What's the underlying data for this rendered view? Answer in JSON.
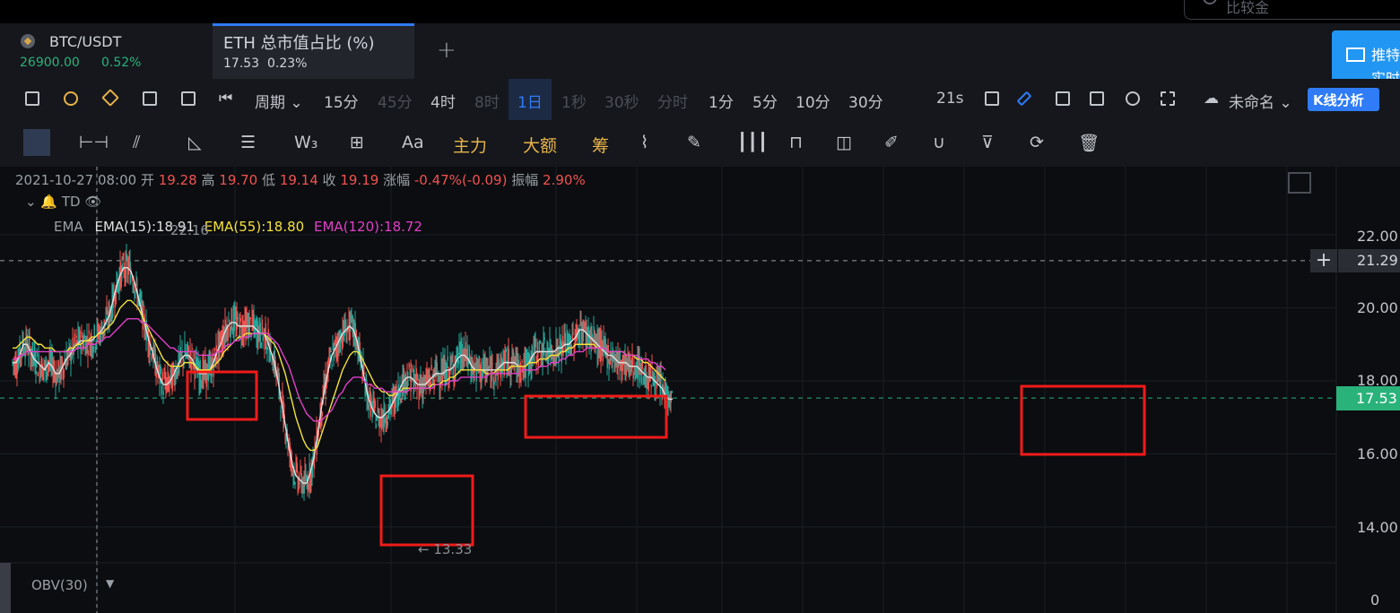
{
  "search": {
    "placeholder": "比较金"
  },
  "tabs": [
    {
      "name": "BTC/USDT",
      "price": "26900.00",
      "change": "0.52%"
    },
    {
      "name": "ETH 总市值占比 (%)",
      "price": "17.53",
      "change": "0.23%"
    }
  ],
  "add_tab": "+",
  "promo": {
    "line1": "推特",
    "line2": "实时"
  },
  "toolbar": {
    "period_label": "周期",
    "intervals": [
      "15分",
      "45分",
      "4时",
      "8时",
      "1日",
      "1秒",
      "30秒",
      "分时",
      "1分",
      "5分",
      "10分",
      "30分"
    ],
    "active_interval": "1日",
    "countdown": "21s",
    "layout_name": "未命名",
    "kline_button": "K线分析"
  },
  "drawing_tools": {
    "text_tool": "Aa",
    "main_force": "主力",
    "large_orders": "大额",
    "chips": "筹"
  },
  "ohlc": {
    "date": "2021-10-27 08:00",
    "open_label": "开",
    "open": "19.28",
    "high_label": "高",
    "high": "19.70",
    "low_label": "低",
    "low": "19.14",
    "close_label": "收",
    "close": "19.19",
    "change_label": "涨幅",
    "change": "-0.47%(-0.09)",
    "amplitude_label": "振幅",
    "amplitude": "2.90%"
  },
  "indicators": {
    "td_label": "TD",
    "ema_label": "EMA",
    "ema15": "EMA(15):18.91",
    "ema55": "EMA(55):18.80",
    "ema120": "EMA(120):18.72",
    "ema15_color": "#e0e0e0",
    "ema55_color": "#f5e13c",
    "ema120_color": "#e040c8"
  },
  "price_axis": {
    "ticks": [
      "22.00",
      "20.00",
      "18.00",
      "16.00",
      "14.00"
    ],
    "crosshair_price": "21.29",
    "last_price": "17.53"
  },
  "annotations": {
    "high_marker": "22.16",
    "low_marker": "← 13.33"
  },
  "obv": {
    "label": "OBV(30)",
    "zero": "0"
  },
  "chart_data": {
    "type": "line",
    "x": [
      0,
      4,
      8,
      12,
      16,
      20,
      24,
      28,
      32,
      36,
      40,
      44,
      48,
      52,
      56,
      60,
      64,
      68,
      72,
      76,
      80,
      84,
      88,
      92,
      96,
      100,
      104,
      108,
      112,
      116,
      120,
      124,
      128,
      132,
      136,
      140,
      144,
      148,
      152,
      156,
      160,
      164,
      168,
      172,
      176,
      180,
      184,
      188,
      192,
      196,
      200,
      204,
      208,
      212,
      216,
      220,
      224,
      228,
      232,
      236,
      240,
      244,
      248,
      252,
      256,
      260,
      264,
      268,
      272,
      276,
      280,
      284,
      288,
      292,
      296,
      300,
      304,
      308,
      312,
      316,
      320,
      324,
      328,
      332,
      336,
      340,
      344,
      348,
      352,
      356,
      360,
      364,
      368,
      372,
      376,
      380,
      384,
      388,
      392,
      396,
      400,
      404,
      408,
      412,
      416,
      420,
      424,
      428,
      432,
      436,
      440,
      444,
      448,
      452,
      456,
      460,
      464,
      468,
      472,
      476,
      480,
      484,
      488,
      492,
      496,
      500,
      504,
      508,
      512,
      516,
      520,
      524,
      528,
      532,
      536,
      540,
      544,
      548,
      552,
      556,
      560,
      564,
      568,
      572,
      576,
      580,
      584,
      588,
      592,
      596,
      600,
      604,
      608,
      612,
      616,
      620,
      624,
      628,
      632,
      636,
      640,
      644,
      648,
      652,
      656,
      660,
      664,
      668,
      672,
      676,
      680,
      684,
      688,
      692,
      696,
      700,
      704,
      708,
      712,
      716,
      720,
      724,
      728,
      732,
      736,
      740,
      744,
      748,
      752,
      756,
      760,
      764,
      768,
      772,
      776,
      780,
      784,
      788,
      792,
      796,
      800,
      804,
      808,
      812,
      816,
      820,
      824,
      828,
      832,
      836,
      840,
      844,
      848,
      852,
      856,
      860,
      864,
      868,
      872,
      876,
      880,
      884,
      888,
      892,
      896,
      900,
      904,
      908,
      912,
      916,
      920,
      924,
      928,
      932,
      936,
      940,
      944,
      948,
      952,
      956,
      960,
      964,
      968,
      972,
      976,
      980,
      984,
      988,
      992,
      996,
      1000,
      1004,
      1008,
      1012,
      1016,
      1020,
      1024,
      1028,
      1032,
      1036,
      1040,
      1044,
      1048,
      1052,
      1056,
      1060,
      1064,
      1068,
      1072,
      1076,
      1080,
      1084,
      1088,
      1092,
      1096,
      1100,
      1104,
      1108,
      1112,
      1116,
      1120,
      1124,
      1128,
      1132,
      1136,
      1140,
      1144,
      1148,
      1152,
      1156,
      1160,
      1164,
      1168,
      1172
    ],
    "series": [
      {
        "name": "EMA(15)",
        "color": "#e0e0e0",
        "values": [
          18.5,
          18.5,
          18.7,
          19.0,
          19.0,
          18.8,
          18.6,
          18.5,
          18.4,
          18.3,
          18.5,
          18.4,
          18.2,
          18.2,
          18.4,
          18.6,
          18.7,
          18.9,
          19.0,
          19.1,
          19.1,
          19.1,
          19.1,
          19.2,
          19.3,
          19.4,
          19.6,
          19.8,
          20.2,
          20.6,
          20.9,
          21.1,
          21.1,
          21.0,
          20.7,
          20.3,
          19.9,
          19.5,
          19.1,
          18.8,
          18.4,
          18.1,
          17.9,
          17.9,
          18.0,
          18.2,
          18.4,
          18.6,
          18.7,
          18.7,
          18.6,
          18.4,
          18.2,
          18.2,
          18.2,
          18.3,
          18.5,
          18.8,
          19.0,
          19.3,
          19.5,
          19.6,
          19.6,
          19.5,
          19.5,
          19.5,
          19.5,
          19.5,
          19.4,
          19.3,
          19.3,
          19.1,
          18.8,
          18.5,
          18.0,
          17.4,
          16.8,
          16.2,
          15.7,
          15.4,
          15.3,
          15.2,
          15.2,
          15.5,
          15.9,
          16.5,
          17.2,
          17.8,
          18.3,
          18.7,
          18.9,
          19.1,
          19.3,
          19.4,
          19.5,
          19.4,
          19.1,
          18.6,
          18.1,
          17.6,
          17.3,
          17.1,
          17.0,
          17.0,
          17.1,
          17.2,
          17.4,
          17.6,
          17.8,
          18.0,
          18.1,
          18.1,
          18.0,
          17.9,
          17.9,
          17.9,
          18.0,
          18.1,
          18.2,
          18.2,
          18.2,
          18.3,
          18.3,
          18.4,
          18.6,
          18.7,
          18.7,
          18.6,
          18.4,
          18.3,
          18.3,
          18.3,
          18.3,
          18.3,
          18.3,
          18.3,
          18.4,
          18.5,
          18.5,
          18.5,
          18.5,
          18.4,
          18.4,
          18.4,
          18.5,
          18.7,
          18.8,
          18.8,
          18.8,
          18.8,
          18.8,
          18.8,
          18.9,
          18.9,
          19.0,
          19.0,
          19.1,
          19.2,
          19.4,
          19.4,
          19.3,
          19.2,
          19.1,
          19.0,
          18.9,
          18.8,
          18.7,
          18.7,
          18.6,
          18.5,
          18.5,
          18.5,
          18.4,
          18.4,
          18.4,
          18.3,
          18.2,
          18.1,
          18.1,
          18.0,
          17.9,
          17.8,
          17.6,
          17.5,
          17.5
        ]
      },
      {
        "name": "EMA(55)",
        "color": "#f5e13c",
        "values": [
          18.9,
          18.9,
          19.0,
          19.1,
          19.2,
          19.2,
          19.1,
          19.0,
          19.0,
          18.9,
          18.9,
          18.9,
          18.8,
          18.8,
          18.8,
          18.8,
          18.9,
          18.9,
          19.0,
          19.0,
          19.1,
          19.1,
          19.2,
          19.2,
          19.3,
          19.3,
          19.4,
          19.5,
          19.6,
          19.8,
          20.0,
          20.1,
          20.2,
          20.2,
          20.1,
          20.0,
          19.8,
          19.6,
          19.4,
          19.2,
          19.0,
          18.8,
          18.6,
          18.5,
          18.4,
          18.4,
          18.4,
          18.4,
          18.5,
          18.5,
          18.5,
          18.4,
          18.3,
          18.3,
          18.3,
          18.3,
          18.4,
          18.5,
          18.6,
          18.8,
          18.9,
          19.0,
          19.1,
          19.2,
          19.2,
          19.3,
          19.3,
          19.3,
          19.3,
          19.3,
          19.3,
          19.2,
          19.1,
          19.0,
          18.8,
          18.5,
          18.2,
          17.8,
          17.4,
          17.0,
          16.7,
          16.4,
          16.2,
          16.1,
          16.1,
          16.2,
          16.5,
          16.8,
          17.1,
          17.4,
          17.7,
          18.0,
          18.3,
          18.5,
          18.7,
          18.8,
          18.8,
          18.7,
          18.5,
          18.3,
          18.1,
          17.9,
          17.8,
          17.7,
          17.7,
          17.6,
          17.6,
          17.7,
          17.7,
          17.8,
          17.8,
          17.8,
          17.8,
          17.8,
          17.8,
          17.8,
          17.8,
          17.9,
          17.9,
          17.9,
          18.0,
          18.0,
          18.1,
          18.1,
          18.2,
          18.3,
          18.3,
          18.3,
          18.3,
          18.3,
          18.3,
          18.3,
          18.2,
          18.2,
          18.2,
          18.3,
          18.3,
          18.3,
          18.3,
          18.4,
          18.4,
          18.4,
          18.4,
          18.4,
          18.5,
          18.5,
          18.5,
          18.6,
          18.6,
          18.6,
          18.7,
          18.7,
          18.7,
          18.8,
          18.8,
          18.9,
          18.9,
          19.0,
          19.0,
          19.0,
          19.0,
          19.0,
          19.0,
          18.9,
          18.9,
          18.9,
          18.8,
          18.8,
          18.8,
          18.8,
          18.8,
          18.7,
          18.7,
          18.7,
          18.6,
          18.6,
          18.5,
          18.5,
          18.4,
          18.3,
          18.2,
          18.1,
          18.0
        ]
      },
      {
        "name": "EMA(120)",
        "color": "#e040c8",
        "values": [
          18.6,
          18.6,
          18.7,
          18.7,
          18.8,
          18.8,
          18.8,
          18.8,
          18.8,
          18.8,
          18.8,
          18.8,
          18.8,
          18.8,
          18.8,
          18.8,
          18.8,
          18.8,
          18.9,
          18.9,
          18.9,
          19.0,
          19.0,
          19.0,
          19.1,
          19.1,
          19.2,
          19.2,
          19.3,
          19.4,
          19.5,
          19.6,
          19.7,
          19.7,
          19.7,
          19.7,
          19.6,
          19.6,
          19.5,
          19.4,
          19.3,
          19.2,
          19.1,
          19.0,
          18.9,
          18.9,
          18.8,
          18.8,
          18.8,
          18.8,
          18.8,
          18.8,
          18.7,
          18.7,
          18.7,
          18.7,
          18.7,
          18.8,
          18.8,
          18.9,
          19.0,
          19.0,
          19.1,
          19.1,
          19.2,
          19.2,
          19.2,
          19.3,
          19.3,
          19.3,
          19.3,
          19.3,
          19.2,
          19.1,
          19.0,
          18.8,
          18.6,
          18.4,
          18.1,
          17.8,
          17.5,
          17.3,
          17.1,
          17.0,
          16.9,
          16.9,
          16.9,
          17.0,
          17.1,
          17.2,
          17.4,
          17.6,
          17.7,
          17.9,
          18.0,
          18.1,
          18.1,
          18.1,
          18.0,
          17.9,
          17.9,
          17.8,
          17.8,
          17.8,
          17.7,
          17.7,
          17.7,
          17.7,
          17.7,
          17.7,
          17.7,
          17.8,
          17.8,
          17.8,
          17.8,
          17.8,
          17.8,
          17.8,
          17.9,
          17.9,
          17.9,
          17.9,
          18.0,
          18.0,
          18.0,
          18.1,
          18.1,
          18.1,
          18.1,
          18.1,
          18.1,
          18.1,
          18.1,
          18.2,
          18.2,
          18.2,
          18.2,
          18.2,
          18.2,
          18.2,
          18.2,
          18.2,
          18.3,
          18.3,
          18.3,
          18.3,
          18.3,
          18.4,
          18.4,
          18.4,
          18.5,
          18.5,
          18.5,
          18.6,
          18.6,
          18.7,
          18.7,
          18.8,
          18.8,
          18.8,
          18.9,
          18.9,
          18.9,
          18.9,
          18.9,
          18.9,
          18.8,
          18.8,
          18.8,
          18.8,
          18.8,
          18.7,
          18.7,
          18.7,
          18.7,
          18.6,
          18.6,
          18.6,
          18.5,
          18.5,
          18.4,
          18.4,
          18.3
        ]
      }
    ],
    "ylim": [
      13.33,
      22.16
    ],
    "highlight_boxes": 5
  }
}
